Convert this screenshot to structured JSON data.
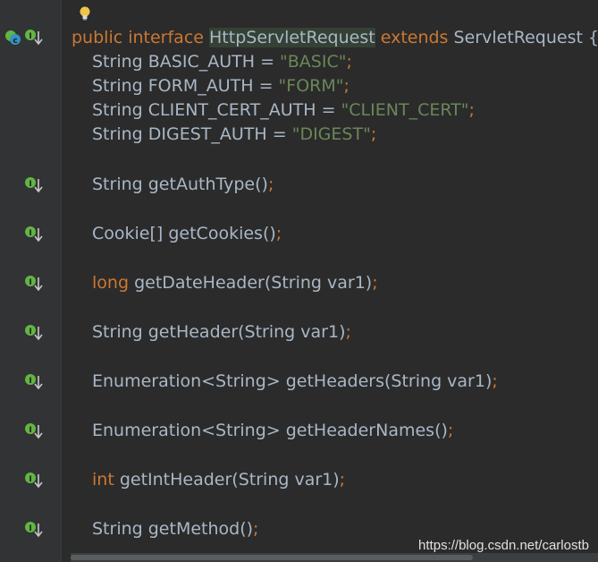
{
  "class_decl": {
    "kw1": "public",
    "kw2": "interface",
    "name": "HttpServletRequest",
    "kw3": "extends",
    "parent": "ServletRequest",
    "brace": "{"
  },
  "constants": [
    {
      "type": "String",
      "name": "BASIC_AUTH",
      "eq": "=",
      "value": "\"BASIC\"",
      "semi": ";"
    },
    {
      "type": "String",
      "name": "FORM_AUTH",
      "eq": "=",
      "value": "\"FORM\"",
      "semi": ";"
    },
    {
      "type": "String",
      "name": "CLIENT_CERT_AUTH",
      "eq": "=",
      "value": "\"CLIENT_CERT\"",
      "semi": ";"
    },
    {
      "type": "String",
      "name": "DIGEST_AUTH",
      "eq": "=",
      "value": "\"DIGEST\"",
      "semi": ";"
    }
  ],
  "methods": [
    {
      "ret": "String",
      "ret_kw": false,
      "sig": "getAuthType()",
      "semi": ";"
    },
    {
      "ret": "Cookie[]",
      "ret_kw": false,
      "sig": "getCookies()",
      "semi": ";"
    },
    {
      "ret": "long",
      "ret_kw": true,
      "sig": "getDateHeader(String var1)",
      "semi": ";"
    },
    {
      "ret": "String",
      "ret_kw": false,
      "sig": "getHeader(String var1)",
      "semi": ";"
    },
    {
      "ret": "Enumeration<String>",
      "ret_kw": false,
      "sig": "getHeaders(String var1)",
      "semi": ";"
    },
    {
      "ret": "Enumeration<String>",
      "ret_kw": false,
      "sig": "getHeaderNames()",
      "semi": ";"
    },
    {
      "ret": "int",
      "ret_kw": true,
      "sig": "getIntHeader(String var1)",
      "semi": ";"
    },
    {
      "ret": "String",
      "ret_kw": false,
      "sig": "getMethod()",
      "semi": ";"
    }
  ],
  "icons": {
    "interface_marker": "implemented-interface-icon",
    "class_badge": "class-c-icon",
    "method_marker": "implemented-method-icon",
    "intention": "lightbulb-icon"
  },
  "watermark": "https://blog.csdn.net/carlostb",
  "colors": {
    "background": "#2b2b2b",
    "gutter": "#313335",
    "keyword": "#cc7832",
    "string": "#6a8759",
    "text": "#a9b7c6",
    "marker": "#62b543",
    "highlight": "#344134"
  }
}
